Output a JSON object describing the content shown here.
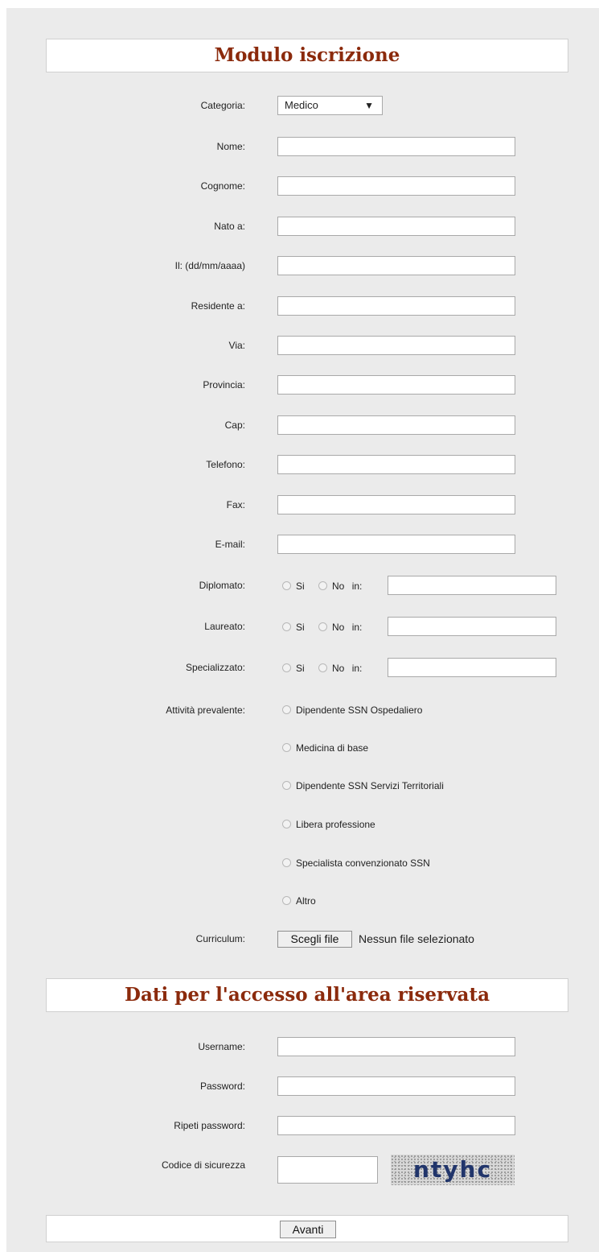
{
  "titles": {
    "main": "Modulo iscrizione",
    "access": "Dati per l'accesso all'area riservata"
  },
  "category": {
    "label": "Categoria:",
    "value": "Medico",
    "arrow": "▼"
  },
  "fields": [
    {
      "label": "Nome:",
      "value": ""
    },
    {
      "label": "Cognome:",
      "value": ""
    },
    {
      "label": "Nato a:",
      "value": ""
    },
    {
      "label": "Il: (dd/mm/aaaa)",
      "value": ""
    },
    {
      "label": "Residente a:",
      "value": ""
    },
    {
      "label": "Via:",
      "value": ""
    },
    {
      "label": "Provincia:",
      "value": ""
    },
    {
      "label": "Cap:",
      "value": ""
    },
    {
      "label": "Telefono:",
      "value": ""
    },
    {
      "label": "Fax:",
      "value": ""
    },
    {
      "label": "E-mail:",
      "value": ""
    }
  ],
  "education": {
    "yes": "Si",
    "no": "No",
    "in": "in:",
    "rows": [
      {
        "label": "Diplomato:"
      },
      {
        "label": "Laureato:"
      },
      {
        "label": "Specializzato:"
      }
    ]
  },
  "activity": {
    "label": "Attività prevalente:",
    "options": [
      "Dipendente SSN Ospedaliero",
      "Medicina di base",
      "Dipendente SSN Servizi Territoriali",
      "Libera professione",
      "Specialista convenzionato SSN",
      "Altro"
    ]
  },
  "curriculum": {
    "label": "Curriculum:",
    "button": "Scegli file",
    "status": "Nessun file selezionato"
  },
  "access": {
    "username": "Username:",
    "password": "Password:",
    "repeat": "Ripeti password:",
    "code": "Codice di sicurezza",
    "captcha": "ntyhc"
  },
  "submit": "Avanti"
}
